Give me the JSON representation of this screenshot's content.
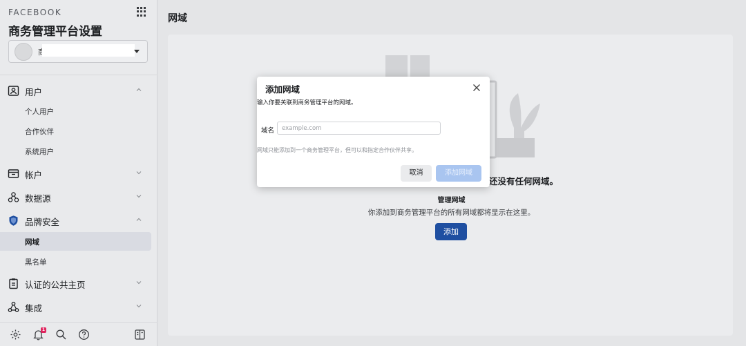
{
  "sidebar": {
    "brand": "FACEBOOK",
    "title": "商务管理平台设置",
    "business_name": "商",
    "nav": [
      {
        "label": "用户",
        "icon": "user-card-icon",
        "expanded": true
      },
      {
        "label": "帐户",
        "icon": "wallet-icon",
        "expanded": false
      },
      {
        "label": "数据源",
        "icon": "data-source-icon",
        "expanded": false
      },
      {
        "label": "品牌安全",
        "icon": "shield-icon",
        "expanded": true
      },
      {
        "label": "认证的公共主页",
        "icon": "clipboard-icon",
        "expanded": false
      },
      {
        "label": "集成",
        "icon": "integration-icon",
        "expanded": false
      }
    ],
    "users_sub": [
      "个人用户",
      "合作伙伴",
      "系统用户"
    ],
    "brand_safety_sub": [
      "网域",
      "黑名单"
    ],
    "active_item": "网域",
    "notification_count": "1",
    "bottom_icons": [
      "settings-icon",
      "bell-icon",
      "search-icon",
      "help-icon",
      "panel-icon"
    ]
  },
  "main": {
    "page_title": "网域",
    "empty_title": "还没有任何网域。",
    "empty_subtitle": "管理网域",
    "empty_desc": "你添加到商务管理平台的所有网域都将显示在这里。",
    "add_label": "添加"
  },
  "modal": {
    "title": "添加网域",
    "desc": "输入你要关联到商务管理平台的网域。",
    "field_label": "域名",
    "field_placeholder": "example.com",
    "field_value": "",
    "hint": "网域只能添加到一个商务管理平台，但可以和指定合作伙伴共享。",
    "cancel_label": "取消",
    "submit_label": "添加网域"
  },
  "colors": {
    "primary": "#1f4fa1",
    "primary_disabled": "#a9c5f0",
    "badge": "#e0245e"
  }
}
